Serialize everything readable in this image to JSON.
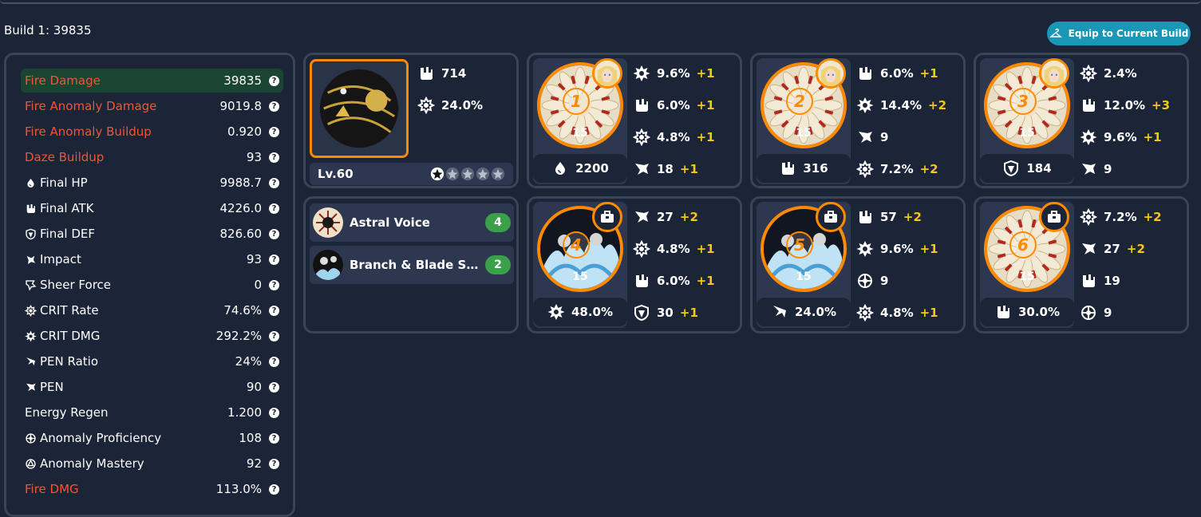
{
  "header": {
    "build_title": "Build 1: 39835",
    "equip_label": "Equip to Current Build"
  },
  "stats": [
    {
      "name": "Fire Damage",
      "value": "39835",
      "red": true,
      "icon": "",
      "highlight": true
    },
    {
      "name": "Fire Anomaly Damage",
      "value": "9019.8",
      "red": true,
      "icon": ""
    },
    {
      "name": "Fire Anomaly Buildup",
      "value": "0.920",
      "red": true,
      "icon": ""
    },
    {
      "name": "Daze Buildup",
      "value": "93",
      "red": true,
      "icon": ""
    },
    {
      "name": "Final HP",
      "value": "9988.7",
      "icon": "hp-icon"
    },
    {
      "name": "Final ATK",
      "value": "4226.0",
      "icon": "atk-icon"
    },
    {
      "name": "Final DEF",
      "value": "826.60",
      "icon": "def-icon"
    },
    {
      "name": "Impact",
      "value": "93",
      "icon": "impact-icon"
    },
    {
      "name": "Sheer Force",
      "value": "0",
      "icon": "sheer-force-icon"
    },
    {
      "name": "CRIT Rate",
      "value": "74.6%",
      "icon": "crit-rate-icon"
    },
    {
      "name": "CRIT DMG",
      "value": "292.2%",
      "icon": "crit-dmg-icon"
    },
    {
      "name": "PEN Ratio",
      "value": "24%",
      "icon": "pen-ratio-icon"
    },
    {
      "name": "PEN",
      "value": "90",
      "icon": "pen-icon"
    },
    {
      "name": "Energy Regen",
      "value": "1.200",
      "icon": ""
    },
    {
      "name": "Anomaly Proficiency",
      "value": "108",
      "icon": "anomaly-proficiency-icon"
    },
    {
      "name": "Anomaly Mastery",
      "value": "92",
      "icon": "anomaly-mastery-icon"
    },
    {
      "name": "Fire DMG",
      "value": "113.0%",
      "red": true,
      "icon": ""
    }
  ],
  "weapon": {
    "level": "Lv.60",
    "stars_filled": 1,
    "stars_total": 5,
    "stats": [
      {
        "icon": "atk-icon",
        "value": "714"
      },
      {
        "icon": "crit-rate-icon",
        "value": "24.0%"
      }
    ]
  },
  "sets": [
    {
      "name": "Astral Voice",
      "count": "4"
    },
    {
      "name": "Branch & Blade So...",
      "count": "2"
    }
  ],
  "discs": [
    {
      "num": "1",
      "level": "15",
      "badge": "character",
      "main": {
        "icon": "hp-icon",
        "value": "2200"
      },
      "subs": [
        {
          "icon": "crit-dmg-icon",
          "value": "9.6%",
          "plus": "+1"
        },
        {
          "icon": "atk-icon",
          "value": "6.0%",
          "plus": "+1"
        },
        {
          "icon": "crit-rate-icon",
          "value": "4.8%",
          "plus": "+1"
        },
        {
          "icon": "pen-icon",
          "value": "18",
          "plus": "+1"
        }
      ]
    },
    {
      "num": "2",
      "level": "15",
      "badge": "character",
      "main": {
        "icon": "atk-icon",
        "value": "316"
      },
      "subs": [
        {
          "icon": "atk-icon",
          "value": "6.0%",
          "plus": "+1"
        },
        {
          "icon": "crit-dmg-icon",
          "value": "14.4%",
          "plus": "+2"
        },
        {
          "icon": "pen-icon",
          "value": "9",
          "plus": ""
        },
        {
          "icon": "crit-rate-icon",
          "value": "7.2%",
          "plus": "+2"
        }
      ]
    },
    {
      "num": "3",
      "level": "15",
      "badge": "character",
      "main": {
        "icon": "def-icon",
        "value": "184"
      },
      "subs": [
        {
          "icon": "crit-rate-icon",
          "value": "2.4%",
          "plus": ""
        },
        {
          "icon": "atk-icon",
          "value": "12.0%",
          "plus": "+3"
        },
        {
          "icon": "crit-dmg-icon",
          "value": "9.6%",
          "plus": "+1"
        },
        {
          "icon": "pen-icon",
          "value": "9",
          "plus": ""
        }
      ]
    },
    {
      "num": "4",
      "level": "15",
      "badge": "toolbox",
      "main": {
        "icon": "crit-dmg-icon",
        "value": "48.0%"
      },
      "subs": [
        {
          "icon": "pen-icon",
          "value": "27",
          "plus": "+2"
        },
        {
          "icon": "crit-rate-icon",
          "value": "4.8%",
          "plus": "+1"
        },
        {
          "icon": "atk-icon",
          "value": "6.0%",
          "plus": "+1"
        },
        {
          "icon": "def-icon",
          "value": "30",
          "plus": "+1"
        }
      ]
    },
    {
      "num": "5",
      "level": "15",
      "badge": "toolbox",
      "main": {
        "icon": "pen-ratio-icon",
        "value": "24.0%"
      },
      "subs": [
        {
          "icon": "atk-icon",
          "value": "57",
          "plus": "+2"
        },
        {
          "icon": "crit-dmg-icon",
          "value": "9.6%",
          "plus": "+1"
        },
        {
          "icon": "anomaly-proficiency-icon",
          "value": "9",
          "plus": ""
        },
        {
          "icon": "crit-rate-icon",
          "value": "4.8%",
          "plus": "+1"
        }
      ]
    },
    {
      "num": "6",
      "level": "15",
      "badge": "toolbox",
      "main": {
        "icon": "atk-icon",
        "value": "30.0%"
      },
      "subs": [
        {
          "icon": "crit-rate-icon",
          "value": "7.2%",
          "plus": "+2"
        },
        {
          "icon": "pen-icon",
          "value": "27",
          "plus": "+2"
        },
        {
          "icon": "atk-icon",
          "value": "19",
          "plus": ""
        },
        {
          "icon": "anomaly-proficiency-icon",
          "value": "9",
          "plus": ""
        }
      ]
    }
  ],
  "colors": {
    "accent_orange": "#ff8a00",
    "fire_red": "#f05535",
    "plus_yellow": "#f5c518",
    "equip_teal": "#1a96b6",
    "set_green": "#3aa04a"
  }
}
